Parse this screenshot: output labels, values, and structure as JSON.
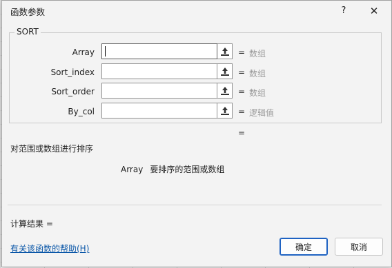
{
  "dialog": {
    "title": "函数参数",
    "help_button": "?",
    "close_button": "✕"
  },
  "function": {
    "name": "SORT",
    "args": [
      {
        "label": "Array",
        "value": "",
        "type": "数组"
      },
      {
        "label": "Sort_index",
        "value": "",
        "type": "数组"
      },
      {
        "label": "Sort_order",
        "value": "",
        "type": "数组"
      },
      {
        "label": "By_col",
        "value": "",
        "type": "逻辑值"
      }
    ],
    "equals": "=",
    "result_equals": "=",
    "description": "对范围或数组进行排序",
    "arg_description": {
      "name": "Array",
      "text": "要排序的范围或数组"
    }
  },
  "footer": {
    "calc_result_label": "计算结果 =",
    "help_link": "有关该函数的帮助(H)",
    "ok_label": "确定",
    "cancel_label": "取消"
  },
  "icons": {
    "collapse": "collapse-dialog-icon"
  },
  "colors": {
    "link": "#0b57a8",
    "primary_border": "#1e62c2"
  }
}
